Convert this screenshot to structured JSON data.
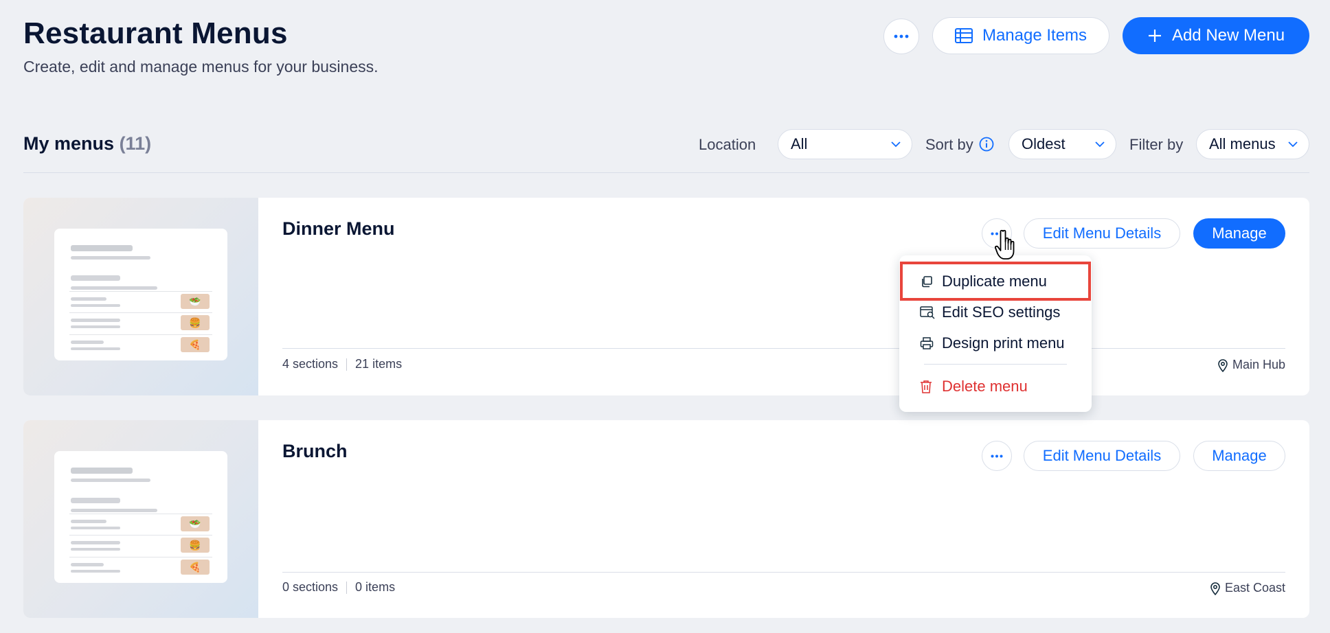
{
  "header": {
    "title": "Restaurant Menus",
    "subtitle": "Create, edit and manage menus for your business.",
    "more_icon": "more-horizontal-icon",
    "manage_items_label": "Manage Items",
    "manage_items_icon": "table-icon",
    "add_menu_label": "Add New Menu",
    "add_menu_icon": "plus-icon"
  },
  "toolbar": {
    "section_title": "My menus",
    "count": "(11)",
    "location_label": "Location",
    "location_value": "All",
    "sort_label": "Sort by",
    "sort_value": "Oldest",
    "filter_label": "Filter by",
    "filter_value": "All menus"
  },
  "menus": [
    {
      "name": "Dinner Menu",
      "sections": "4 sections",
      "items": "21 items",
      "location": "Main Hub",
      "edit_label": "Edit Menu Details",
      "manage_label": "Manage"
    },
    {
      "name": "Brunch",
      "sections": "0 sections",
      "items": "0 items",
      "location": "East Coast",
      "edit_label": "Edit Menu Details",
      "manage_label": "Manage"
    }
  ],
  "context_menu": {
    "items": [
      {
        "label": "Duplicate menu",
        "icon": "duplicate-icon"
      },
      {
        "label": "Edit SEO settings",
        "icon": "seo-icon"
      },
      {
        "label": "Design print menu",
        "icon": "printer-icon"
      },
      {
        "label": "Delete menu",
        "icon": "trash-icon"
      }
    ]
  },
  "colors": {
    "accent": "#116dff",
    "danger": "#df3131",
    "highlight": "#e8453c",
    "background": "#eef0f4"
  }
}
